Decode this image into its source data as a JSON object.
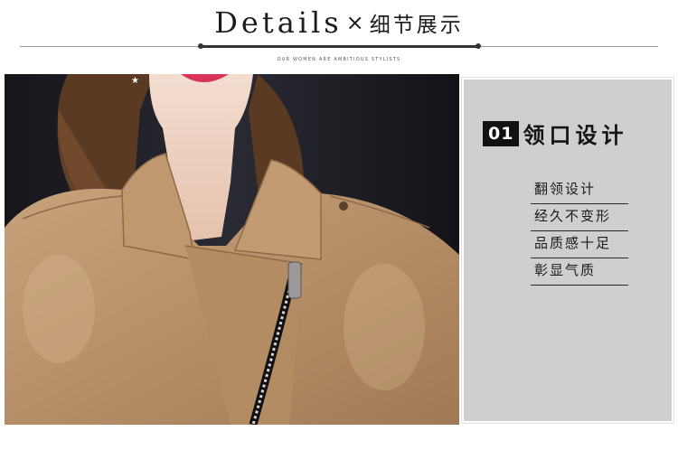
{
  "header": {
    "title_en": "Details",
    "separator": "×",
    "title_cn": "细节展示",
    "subtitle": "OUR WOMEN ARE AMBITIOUS STYLISTS"
  },
  "photo": {
    "subject": "collar-zipper-closeup"
  },
  "panel": {
    "badge": "01",
    "heading": "领口设计",
    "features": [
      "翻领设计",
      "经久不变形",
      "品质感十足",
      "彰显气质"
    ]
  },
  "colors": {
    "panel_bg": "#cfcfcf",
    "jacket": "#b9936d",
    "background_dark": "#1a1a20"
  }
}
